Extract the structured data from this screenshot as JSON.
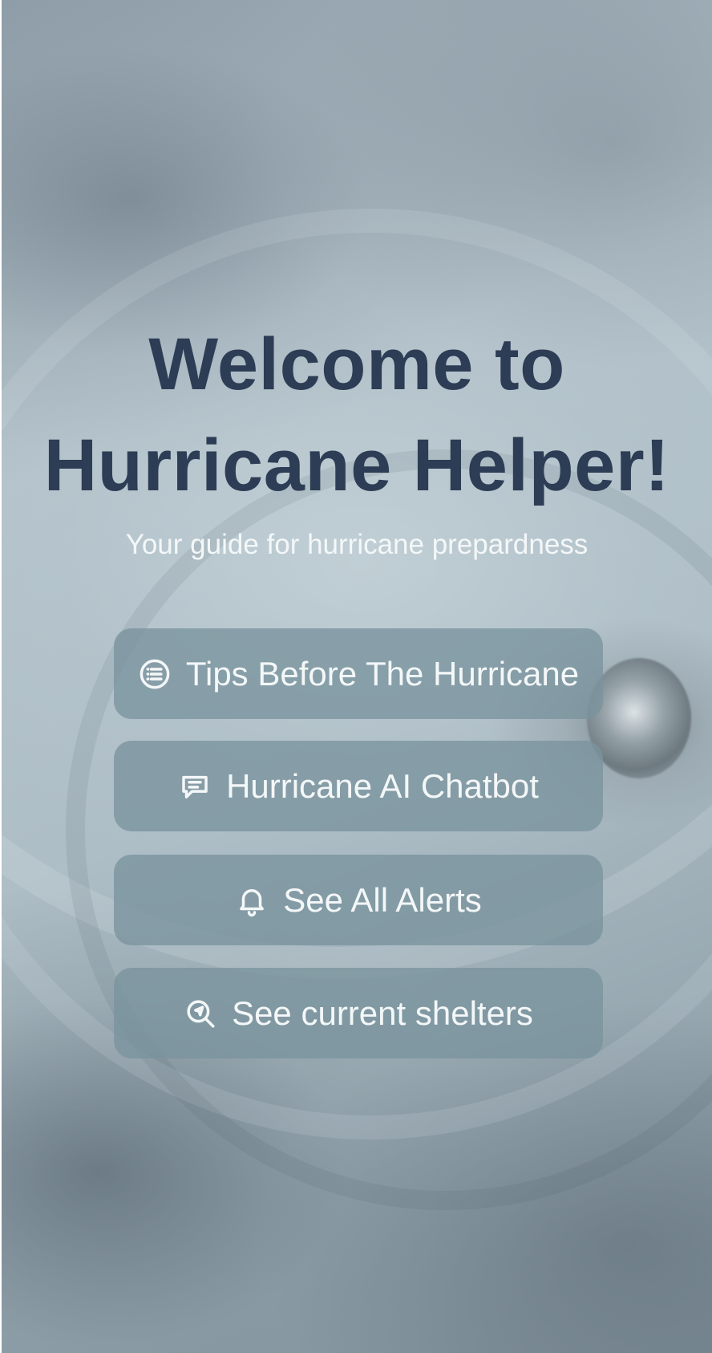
{
  "welcome": {
    "title_line_1": "Welcome to",
    "title_line_2": "Hurricane Helper!",
    "subtitle": "Your guide for hurricane prepardness"
  },
  "menu": {
    "items": [
      {
        "label": "Tips Before The Hurricane",
        "icon": "list-circle-icon"
      },
      {
        "label": "Hurricane AI Chatbot",
        "icon": "chat-bubble-icon"
      },
      {
        "label": "See All Alerts",
        "icon": "bell-icon"
      },
      {
        "label": "See current shelters",
        "icon": "location-search-icon"
      }
    ]
  },
  "colors": {
    "title": "#2d3d55",
    "button_background": "#7a939e",
    "button_text": "#f4f7f8"
  }
}
